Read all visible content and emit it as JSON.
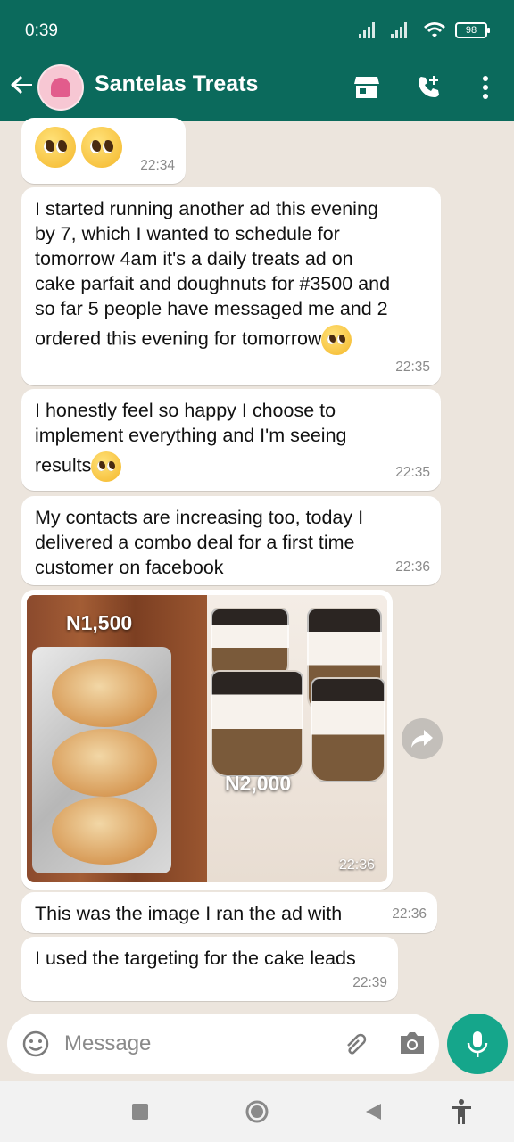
{
  "status": {
    "time": "0:39",
    "battery": "98"
  },
  "header": {
    "title": "Santelas Treats"
  },
  "messages": [
    {
      "text": "",
      "time": "22:34"
    },
    {
      "lines": [
        "I started running another ad this evening",
        "by 7, which I wanted to schedule for",
        "tomorrow 4am it's a daily treats ad on",
        "cake parfait and doughnuts for #3500 and",
        "so far 5 people have messaged me and 2",
        "ordered this evening for tomorrow"
      ],
      "time": "22:35"
    },
    {
      "lines": [
        "I honestly feel so happy I choose to",
        "implement everything and I'm seeing",
        "results"
      ],
      "time": "22:35"
    },
    {
      "lines": [
        "My contacts are increasing too, today I",
        "delivered a combo deal for a first time",
        "customer on facebook"
      ],
      "time": "22:36"
    },
    {
      "image": {
        "price_left": "N1,500",
        "price_right": "N2,000"
      },
      "time": "22:36"
    },
    {
      "text": "This was the image I ran the ad with",
      "time": "22:36"
    },
    {
      "text": "I used the targeting for the cake leads",
      "time": "22:39"
    }
  ],
  "input": {
    "placeholder": "Message"
  }
}
